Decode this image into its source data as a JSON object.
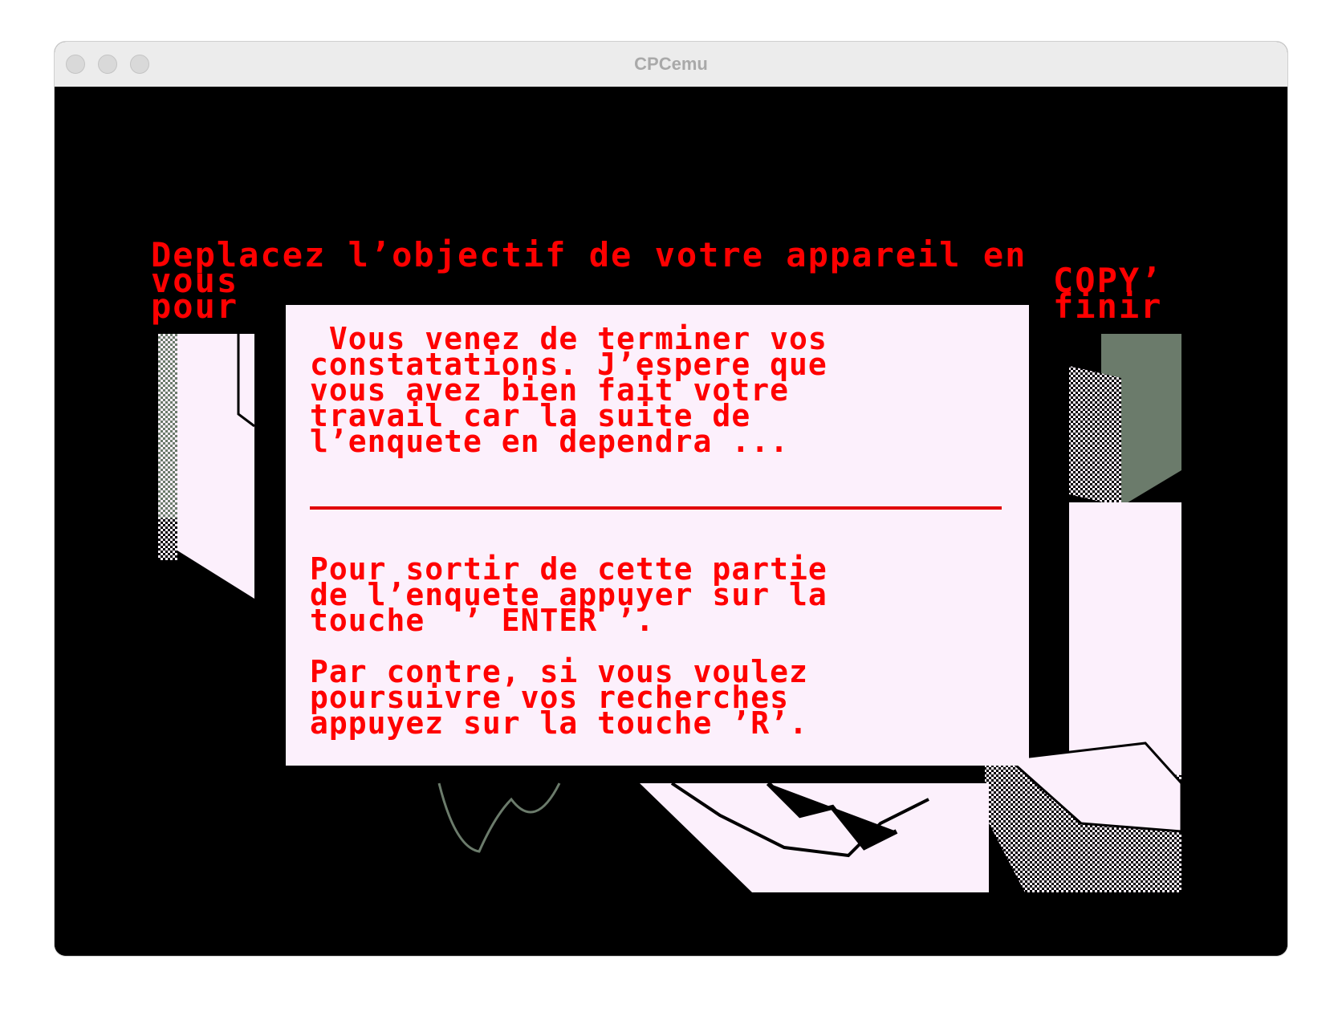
{
  "window": {
    "title": "CPCemu"
  },
  "game": {
    "top_line_1": "Deplacez l’objectif de votre appareil en",
    "top_line_2_left": "vous",
    "top_line_2_right": "COPY’",
    "top_line_3_left": "pour",
    "top_line_3_right": "finir",
    "dialog": {
      "paragraph_1": " Vous venez de terminer vos\nconstatations. J’espere que\nvous avez bien fait votre\ntravail car la suite de\nl’enquete en dependra ...",
      "paragraph_2": "Pour sortir de cette partie\nde l’enquete appuyer sur la\ntouche  ’ ENTER ’.",
      "paragraph_3": "Par contre, si vous voulez\npoursuivre vos recherches\nappuyez sur la touche ’R’."
    }
  },
  "colors": {
    "text_red": "#ff0000",
    "dialog_bg": "#fcf0fc",
    "scene_gray": "#6b7b6b"
  }
}
